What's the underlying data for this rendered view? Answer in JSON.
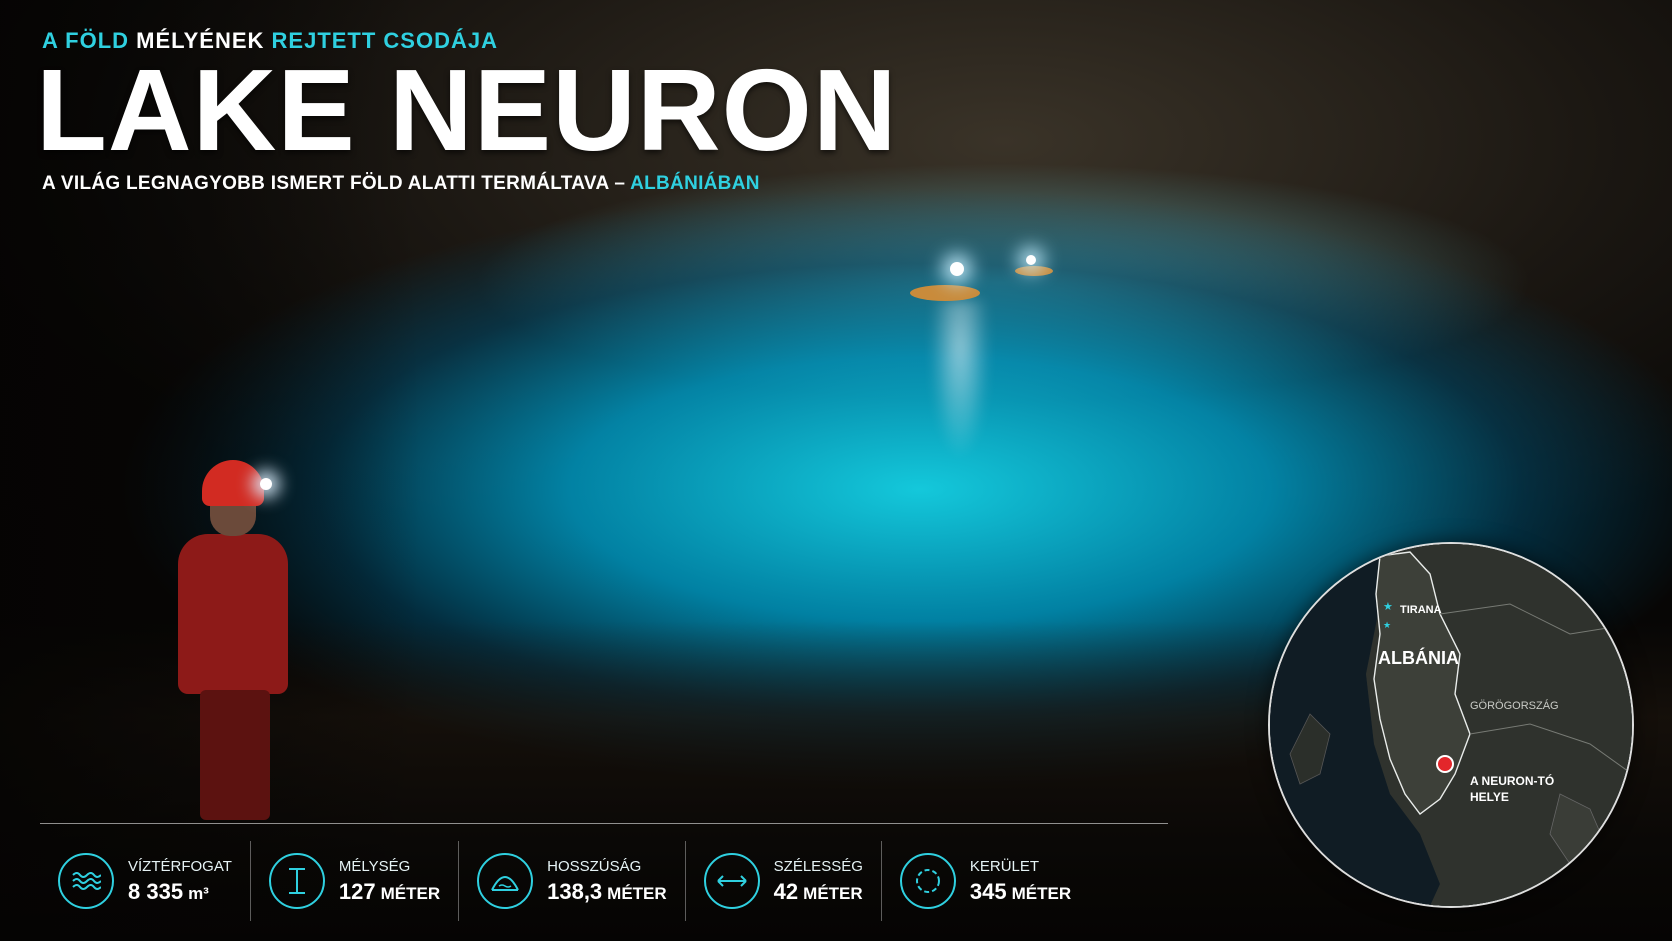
{
  "header": {
    "overline": [
      {
        "text": "A FÖLD",
        "accent": true
      },
      {
        "text": " MÉLYÉNEK ",
        "accent": false
      },
      {
        "text": "REJTETT CSODÁJA",
        "accent": true
      }
    ],
    "title": "LAKE NEURON",
    "subtitle_main": "A VILÁG LEGNAGYOBB ISMERT FÖLD ALATTI TERMÁLTAVA – ",
    "subtitle_accent": "ALBÁNIÁBAN"
  },
  "stats": [
    {
      "label": "VÍZTÉRFOGAT",
      "value": "8 335",
      "unit": "m³",
      "icon": "waves-icon"
    },
    {
      "label": "MÉLYSÉG",
      "value": "127",
      "unit": "MÉTER",
      "icon": "depth-icon"
    },
    {
      "label": "HOSSZÚSÁG",
      "value": "138,3",
      "unit": "MÉTER",
      "icon": "cave-length-icon"
    },
    {
      "label": "SZÉLESSÉG",
      "value": "42",
      "unit": "MÉTER",
      "icon": "width-arrows-icon"
    },
    {
      "label": "KERÜLET",
      "value": "345",
      "unit": "MÉTER",
      "icon": "perimeter-icon"
    }
  ],
  "map": {
    "capital": "TIRANA",
    "country": "ALBÁNIA",
    "neighbor": "GÖRÖGORSZÁG",
    "location_line1": "A NEURON-TÓ",
    "location_line2": "HELYE"
  },
  "colors": {
    "accent": "#2fd0e0",
    "marker": "#e3262b"
  }
}
